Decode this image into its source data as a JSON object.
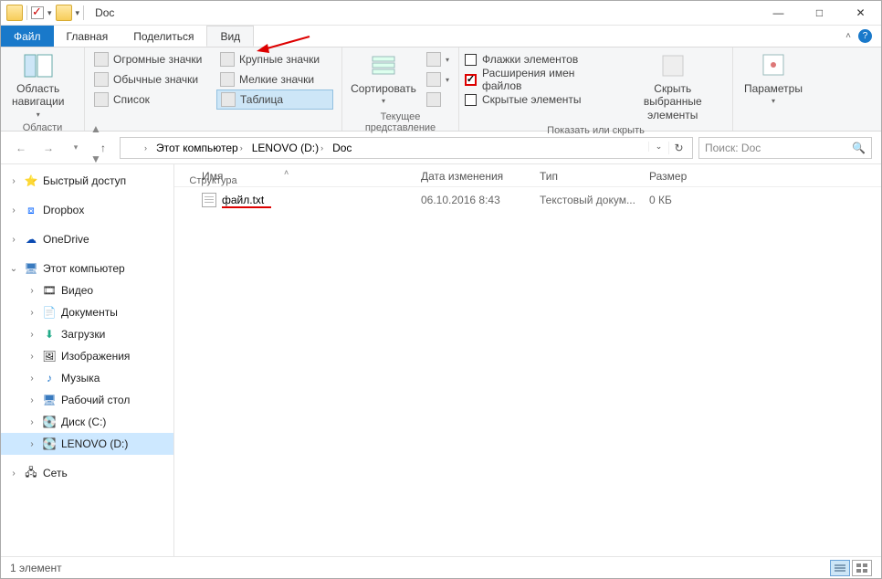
{
  "window": {
    "title": "Doc"
  },
  "tabs": {
    "file": "Файл",
    "home": "Главная",
    "share": "Поделиться",
    "view": "Вид"
  },
  "ribbon": {
    "panes": {
      "nav_pane": "Область\nнавигации",
      "nav_group": "Области"
    },
    "layout": {
      "extra_large": "Огромные значки",
      "large": "Крупные значки",
      "medium": "Обычные значки",
      "small": "Мелкие значки",
      "list": "Список",
      "details": "Таблица",
      "group": "Структура"
    },
    "current_view": {
      "sort": "Сортировать",
      "group": "Текущее представление"
    },
    "show_hide": {
      "item_check": "Флажки элементов",
      "file_ext": "Расширения имен файлов",
      "hidden": "Скрытые элементы",
      "hide_selected": "Скрыть выбранные\nэлементы",
      "group": "Показать или скрыть"
    },
    "options": {
      "label": "Параметры"
    }
  },
  "breadcrumb": {
    "pc": "Этот компьютер",
    "drive": "LENOVO (D:)",
    "folder": "Doc"
  },
  "search": {
    "placeholder": "Поиск: Doc"
  },
  "sidebar": {
    "quick": "Быстрый доступ",
    "dropbox": "Dropbox",
    "onedrive": "OneDrive",
    "pc": "Этот компьютер",
    "video": "Видео",
    "docs": "Документы",
    "downloads": "Загрузки",
    "pictures": "Изображения",
    "music": "Музыка",
    "desktop": "Рабочий стол",
    "cdisk": "Диск (C:)",
    "ddisk": "LENOVO (D:)",
    "network": "Сеть"
  },
  "columns": {
    "name": "Имя",
    "date": "Дата изменения",
    "type": "Тип",
    "size": "Размер"
  },
  "files": [
    {
      "name": "файл.txt",
      "date": "06.10.2016 8:43",
      "type": "Текстовый докум...",
      "size": "0 КБ"
    }
  ],
  "status": {
    "count": "1 элемент"
  }
}
